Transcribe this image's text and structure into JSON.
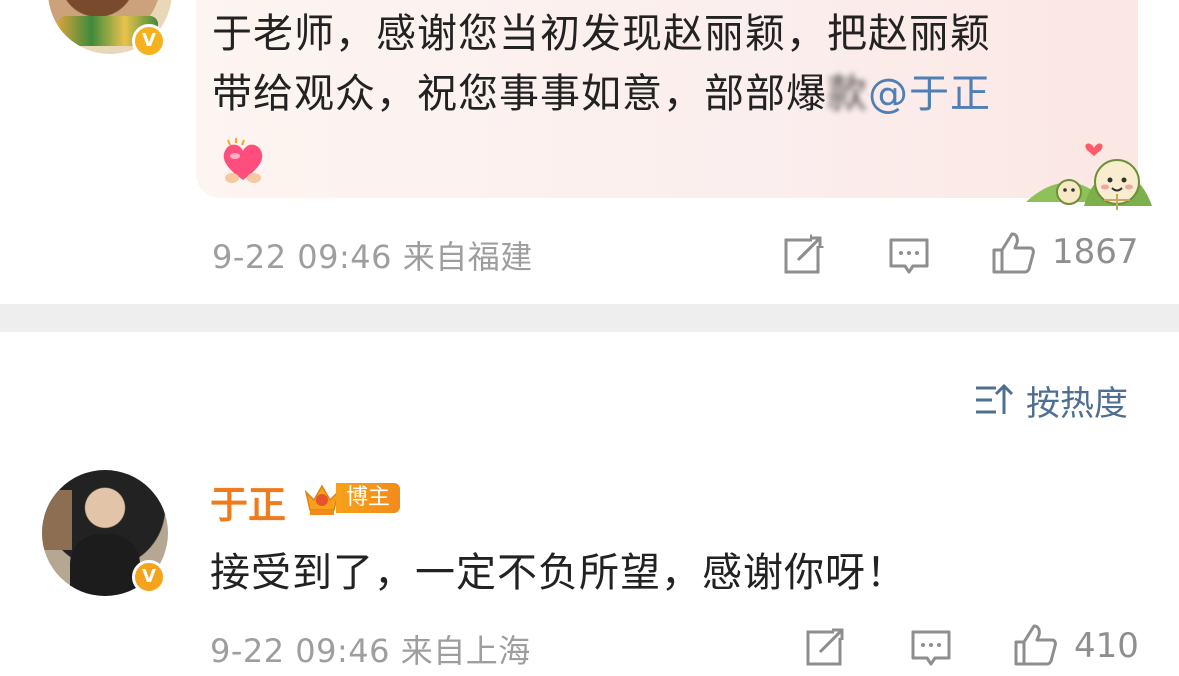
{
  "top_comment": {
    "line1": "于老师，感谢您当初发现赵丽颖，把赵丽颖",
    "line2_main": "带给观众，祝您事事如意，部部爆",
    "line2_blurred": "款",
    "mention": "@于正",
    "emoji": "heart-hands-emoji",
    "sticker": "zongzi-sticker",
    "time": "9-22 09:46",
    "location": "来自福建",
    "like_count": "1867"
  },
  "sort": {
    "label": "按热度",
    "icon": "sort-icon"
  },
  "reply": {
    "username": "于正",
    "badge_label": "博主",
    "text": "接受到了，一定不负所望，感谢你呀！",
    "time": "9-22 09:46",
    "location": "来自上海",
    "like_count": "410"
  },
  "colors": {
    "accent_blue": "#4f7fb4",
    "username_orange": "#f07b1d",
    "meta_gray": "#9e9e9e",
    "badge_gold": "#f5b21c",
    "separator": "#eeeeee"
  }
}
